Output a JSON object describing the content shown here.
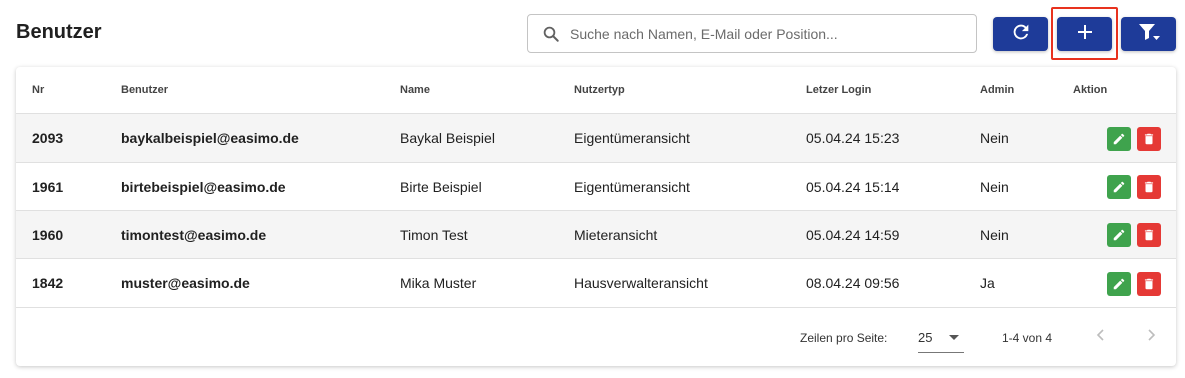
{
  "page": {
    "title": "Benutzer"
  },
  "search": {
    "placeholder": "Suche nach Namen, E-Mail oder Position...",
    "value": ""
  },
  "toolbar": {
    "refresh_icon": "refresh-icon",
    "add_icon": "plus-icon",
    "filter_icon": "filter-dropdown-icon",
    "button_color": "#1e3b99",
    "highlight_color": "#e8321e"
  },
  "table": {
    "columns": {
      "nr": "Nr",
      "user": "Benutzer",
      "name": "Name",
      "type": "Nutzertyp",
      "login": "Letzer Login",
      "admin": "Admin",
      "action": "Aktion"
    },
    "rows": [
      {
        "nr": "2093",
        "user": "baykalbeispiel@easimo.de",
        "name": "Baykal Beispiel",
        "type": "Eigentümeransicht",
        "login": "05.04.24 15:23",
        "admin": "Nein"
      },
      {
        "nr": "1961",
        "user": "birtebeispiel@easimo.de",
        "name": "Birte Beispiel",
        "type": "Eigentümeransicht",
        "login": "05.04.24 15:14",
        "admin": "Nein"
      },
      {
        "nr": "1960",
        "user": "timontest@easimo.de",
        "name": "Timon Test",
        "type": "Mieteransicht",
        "login": "05.04.24 14:59",
        "admin": "Nein"
      },
      {
        "nr": "1842",
        "user": "muster@easimo.de",
        "name": "Mika Muster",
        "type": "Hausverwalteransicht",
        "login": "08.04.24 09:56",
        "admin": "Ja"
      }
    ],
    "edit_color": "#3fa34d",
    "delete_color": "#e53935"
  },
  "pagination": {
    "rows_label": "Zeilen pro Seite:",
    "rows_per_page": "25",
    "range": "1-4 von 4"
  }
}
